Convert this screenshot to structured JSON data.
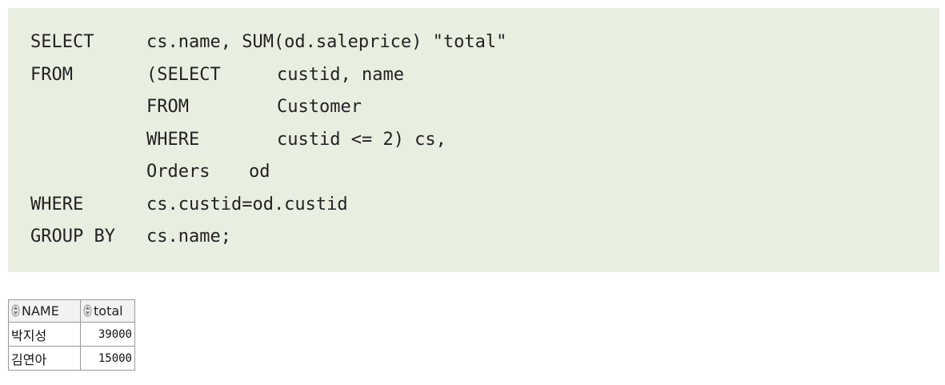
{
  "code": {
    "lines": [
      {
        "a": "SELECT",
        "b": "cs.name, SUM(od.saleprice) \"total\""
      },
      {
        "a": "FROM",
        "b": "(SELECT",
        "c": "custid, name"
      },
      {
        "b": "FROM",
        "c": "Customer"
      },
      {
        "b": "WHERE",
        "c": "custid <= 2) cs,"
      },
      {
        "b": "Orders",
        "d": "od"
      },
      {
        "a": "WHERE",
        "b": "cs.custid=od.custid"
      },
      {
        "a": "GROUP BY",
        "b": "cs.name;"
      }
    ]
  },
  "result": {
    "columns": [
      "NAME",
      "total"
    ],
    "rows": [
      [
        "박지성",
        "39000"
      ],
      [
        "김연아",
        "15000"
      ]
    ]
  },
  "colors": {
    "code_background": "#e8efe1",
    "grid_border": "#9a9a9a",
    "header_background": "#f2f2f2"
  }
}
